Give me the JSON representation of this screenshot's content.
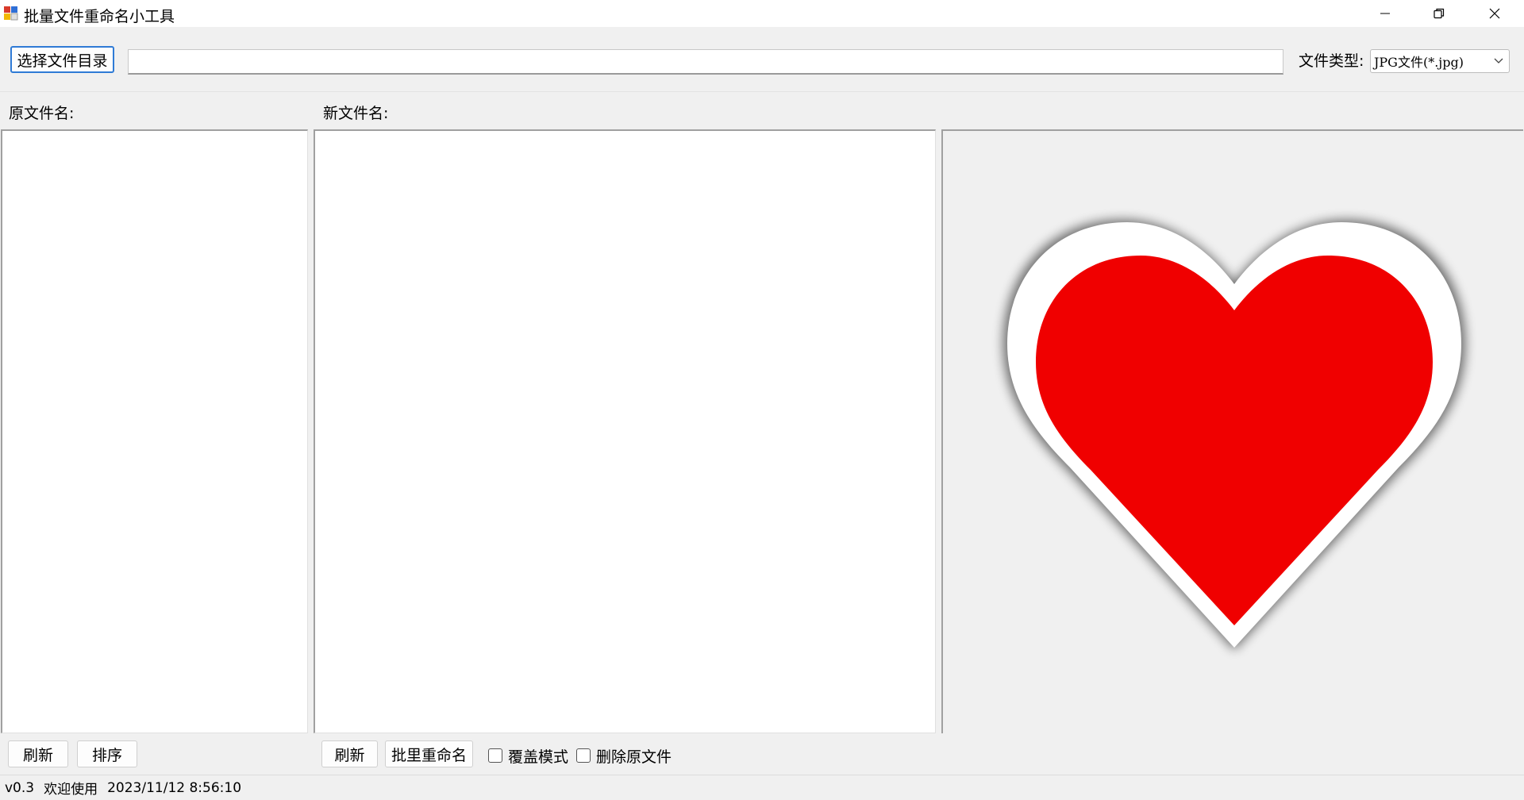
{
  "window": {
    "title": "批量文件重命名小工具",
    "icon": "app-icon",
    "controls": [
      "minimize-icon",
      "restore-icon",
      "close-icon"
    ]
  },
  "toolbar": {
    "select_dir_label": "选择文件目录",
    "dir_path_value": "",
    "file_type_label": "文件类型:",
    "file_type_selected": "JPG文件(*.jpg)"
  },
  "columns": {
    "original_label": "原文件名:",
    "new_label": "新文件名:"
  },
  "original_list": {
    "items": []
  },
  "new_list": {
    "items": []
  },
  "preview": {
    "image": "red-heart-image",
    "colors": {
      "heart": "#f00000",
      "outline": "#ffffff",
      "background": "#f0f0f0"
    }
  },
  "left_buttons": {
    "refresh_label": "刷新",
    "sort_label": "排序"
  },
  "right_buttons": {
    "refresh_label": "刷新",
    "batch_rename_label": "批里重命名",
    "overwrite_label": "覆盖模式",
    "delete_original_label": "删除原文件"
  },
  "status": {
    "version": "v0.3",
    "welcome": "欢迎使用",
    "datetime": "2023/11/12 8:56:10"
  },
  "colors": {
    "accent": "#2f7bd6",
    "window_bg": "#f0f0f0",
    "titlebar_bg": "#ffffff"
  }
}
